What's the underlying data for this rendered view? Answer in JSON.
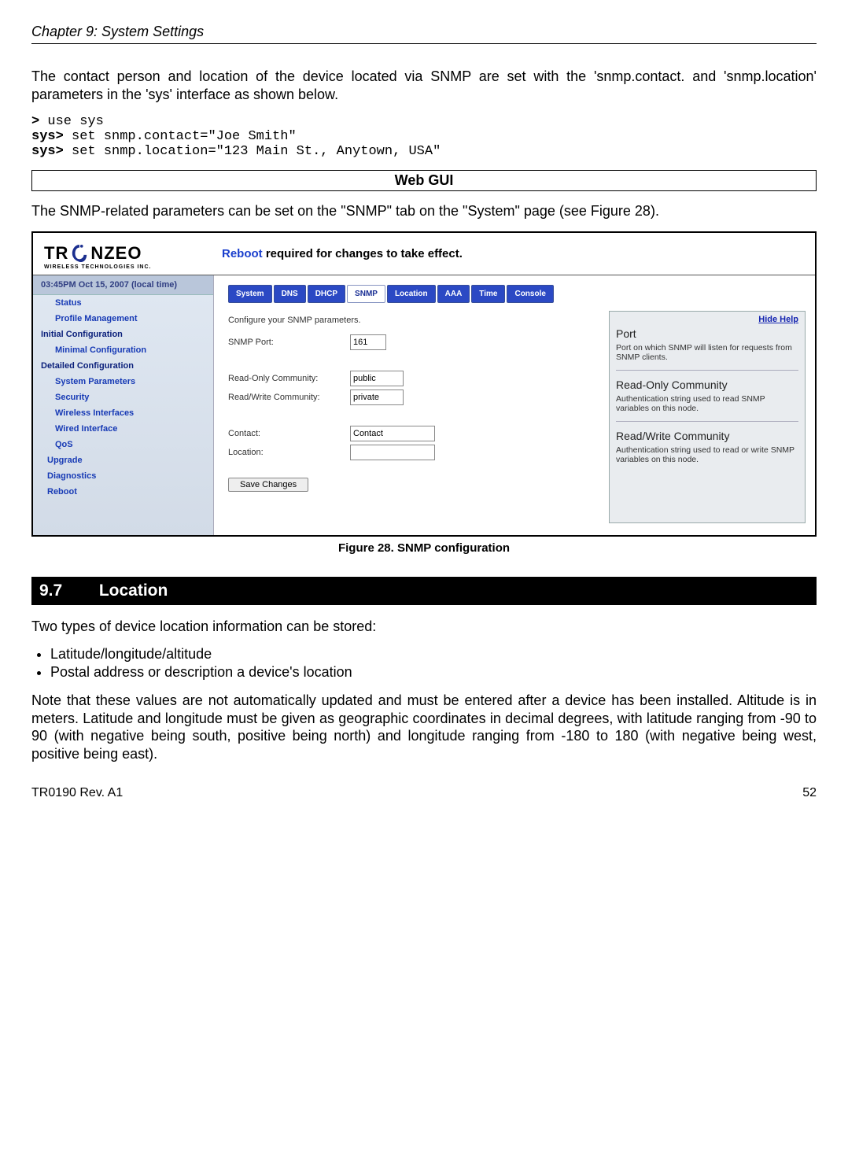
{
  "chapter_header": "Chapter 9: System Settings",
  "intro_para": "The contact person and location of the device located via SNMP are set with the 'snmp.contact. and 'snmp.location' parameters in the 'sys' interface as shown below.",
  "cli": {
    "p1": ">",
    "c1": " use sys",
    "p2": "sys>",
    "c2": " set snmp.contact=\"Joe Smith\"",
    "p3": "sys>",
    "c3": " set snmp.location=\"123 Main St., Anytown, USA\""
  },
  "webgui_title": "Web GUI",
  "webgui_para": "The SNMP-related parameters can be set on the \"SNMP\" tab on the \"System\" page (see Figure 28).",
  "screenshot": {
    "logo_main": "TRANZEO",
    "logo_sub": "WIRELESS TECHNOLOGIES INC.",
    "reboot_prefix": "Reboot",
    "reboot_rest": " required for changes to take effect.",
    "timestamp": "03:45PM Oct 15, 2007 (local time)",
    "sidebar": {
      "status": "Status",
      "profile": "Profile Management",
      "initial": "Initial Configuration",
      "minimal": "Minimal Configuration",
      "detailed": "Detailed Configuration",
      "sysparams": "System Parameters",
      "security": "Security",
      "wireless": "Wireless Interfaces",
      "wired": "Wired Interface",
      "qos": "QoS",
      "upgrade": "Upgrade",
      "diagnostics": "Diagnostics",
      "reboot": "Reboot"
    },
    "tabs": {
      "system": "System",
      "dns": "DNS",
      "dhcp": "DHCP",
      "snmp": "SNMP",
      "location": "Location",
      "aaa": "AAA",
      "time": "Time",
      "console": "Console"
    },
    "form": {
      "hint": "Configure your SNMP parameters.",
      "port_label": "SNMP Port:",
      "port_value": "161",
      "ro_label": "Read-Only Community:",
      "ro_value": "public",
      "rw_label": "Read/Write Community:",
      "rw_value": "private",
      "contact_label": "Contact:",
      "contact_value": "Contact",
      "location_label": "Location:",
      "location_value": "",
      "save": "Save Changes"
    },
    "help": {
      "hide": "Hide Help",
      "h1": "Port",
      "p1": "Port on which SNMP will listen for requests from SNMP clients.",
      "h2": "Read-Only Community",
      "p2": "Authentication string used to read SNMP variables on this node.",
      "h3": "Read/Write Community",
      "p3": "Authentication string used to read or write SNMP variables on this node."
    }
  },
  "figure_caption": "Figure 28. SNMP configuration",
  "section": {
    "num": "9.7",
    "title": "Location"
  },
  "loc_para1": "Two types of device location information can be stored:",
  "bullets": {
    "b1": "Latitude/longitude/altitude",
    "b2": "Postal address or description a device's location"
  },
  "loc_para2": "Note that these values are not automatically updated and must be entered after a device has been installed. Altitude is in meters. Latitude and longitude must be given as geographic coordinates in decimal degrees, with latitude ranging from -90 to 90 (with negative being south, positive being north) and longitude ranging from -180 to 180 (with negative being west, positive being east).",
  "footer": {
    "left": "TR0190 Rev. A1",
    "right": "52"
  }
}
